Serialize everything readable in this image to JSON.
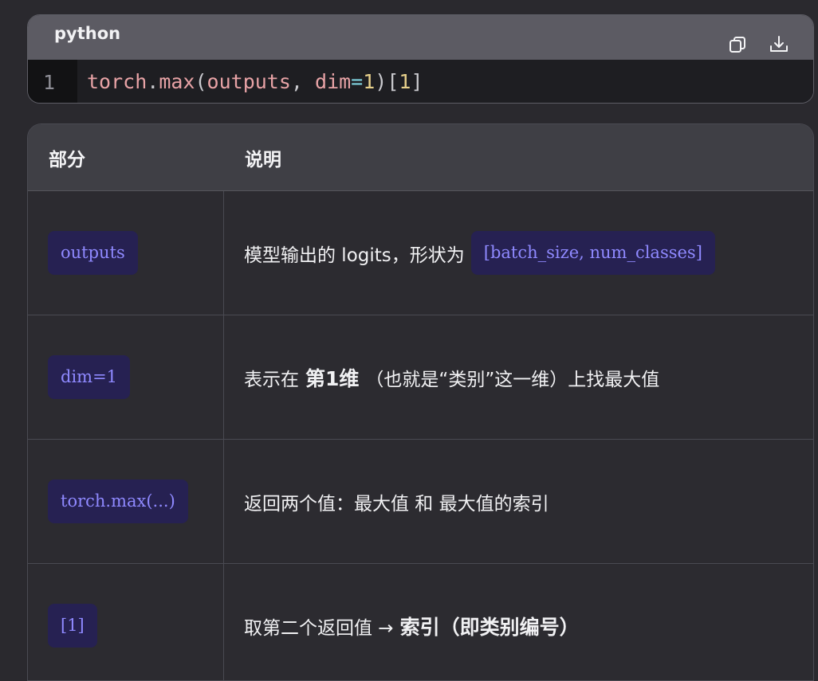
{
  "code": {
    "language": "python",
    "line_number": "1",
    "tokens": {
      "t1": "torch",
      "t2": ".",
      "t3": "max",
      "t4": "(",
      "t5": "outputs",
      "t6": ", ",
      "t7": "dim",
      "t8": "=",
      "t9": "1",
      "t10": ")[",
      "t11": "1",
      "t12": "]"
    },
    "icons": {
      "copy": "copy-icon",
      "download": "download-icon"
    }
  },
  "table": {
    "headers": [
      "部分",
      "说明"
    ],
    "rows": [
      {
        "part": "outputs",
        "desc_prefix": "模型输出的 logits，形状为",
        "desc_code": "[batch_size, num_classes]"
      },
      {
        "part": "dim=1",
        "desc_a": "表示在",
        "desc_strong": "第1维",
        "desc_b": "（也就是“类别”这一维）上找最大值"
      },
      {
        "part": "torch.max(...)",
        "desc": "返回两个值：最大值 和 最大值的索引"
      },
      {
        "part": "[1]",
        "desc_a": "取第二个返回值 →",
        "desc_strong": "索引（即类别编号）"
      }
    ]
  },
  "colors": {
    "background": "#2a292e",
    "code_header": "#5c5b63",
    "chip_bg": "#262152",
    "chip_text": "#8f89ff"
  }
}
